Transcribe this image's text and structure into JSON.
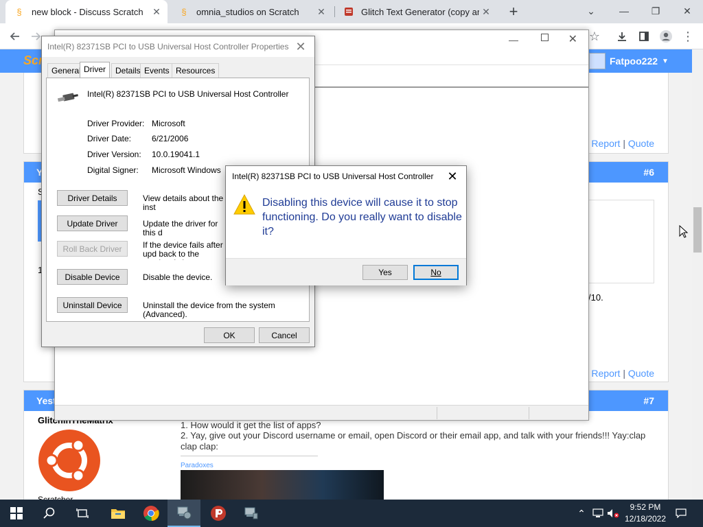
{
  "browser": {
    "tabs": [
      {
        "title": "new block - Discuss Scratch",
        "close": "✕"
      },
      {
        "title": "omnia_studios on Scratch",
        "close": "✕"
      },
      {
        "title": "Glitch Text Generator (copy and p",
        "close": "✕"
      }
    ],
    "new_tab": "+",
    "window_controls": [
      "⌄",
      "—",
      "❐",
      "✕"
    ],
    "toolbar_icons": [
      "back-arrow-icon",
      "forward-arrow-icon",
      "star-icon",
      "download-icon",
      "sidebar-icon",
      "profile-icon",
      "menu-icon"
    ]
  },
  "page": {
    "username": "Fatpoo222",
    "post6": {
      "number": "#6",
      "author_initial": "Y",
      "side_text": "S",
      "side_text2": "1",
      "snippet": "/10.",
      "report": "Report",
      "separator": "|",
      "quote": "Quote"
    },
    "post_top": {
      "report": "Report",
      "separator": "|",
      "quote": "Quote"
    },
    "post7": {
      "number": "#7",
      "author": "Yest",
      "name_line": "GlitchinTheMatrix",
      "role": "Scratcher",
      "line1": "1. How would it get the list of apps?",
      "line2": "2. Yay, give out your Discord username or email, open Discord or their email app, and talk with your friends!!! Yay:clap clap clap:",
      "signature": "Paradoxes"
    }
  },
  "properties_dialog": {
    "title": "Intel(R) 82371SB PCI to USB Universal Host Controller Properties",
    "tabs": [
      "General",
      "Driver",
      "Details",
      "Events",
      "Resources"
    ],
    "device_name": "Intel(R) 82371SB PCI to USB Universal Host Controller",
    "fields": [
      {
        "label": "Driver Provider:",
        "value": "Microsoft"
      },
      {
        "label": "Driver Date:",
        "value": "6/21/2006"
      },
      {
        "label": "Driver Version:",
        "value": "10.0.19041.1"
      },
      {
        "label": "Digital Signer:",
        "value": "Microsoft Windows"
      }
    ],
    "actions": [
      {
        "button": "Driver Details",
        "desc": "View details about the inst"
      },
      {
        "button": "Update Driver",
        "desc": "Update the driver for this d"
      },
      {
        "button": "Roll Back Driver",
        "desc": "If the device fails after upd back to the previously inst"
      },
      {
        "button": "Disable Device",
        "desc": "Disable the device."
      },
      {
        "button": "Uninstall Device",
        "desc": "Uninstall the device from the system (Advanced)."
      }
    ],
    "ok": "OK",
    "cancel": "Cancel"
  },
  "confirm_dialog": {
    "title": "Intel(R) 82371SB PCI to USB Universal Host Controller",
    "message": "Disabling this device will cause it to stop functioning. Do you really want to disable it?",
    "yes": "Yes",
    "no": "No"
  },
  "taskbar": {
    "time": "9:52 PM",
    "date": "12/18/2022"
  },
  "colors": {
    "scratch_blue": "#4d97ff",
    "dialog_text_blue": "#1f3b95",
    "taskbar": "#1c2a3a",
    "focus_blue": "#0078d7"
  }
}
